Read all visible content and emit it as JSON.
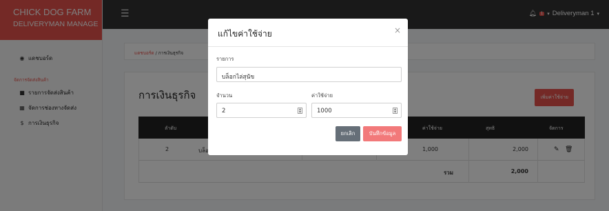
{
  "brand": {
    "title": "CHICK DOG FARM",
    "subtitle": "DELIVERYMAN MANAGE"
  },
  "sidebar": {
    "dashboard": {
      "icon": "dashboard-icon",
      "label": "แดชบอร์ด"
    },
    "section_label": "จัดการจัดส่งสินค้า",
    "items": [
      {
        "icon": "truck-icon",
        "label": "รายการจัดส่งสินค้า"
      },
      {
        "icon": "map-icon",
        "label": "จัดการช่องทางจัดส่ง"
      },
      {
        "icon": "dollar-icon",
        "label": "การเงินธุรกิจ"
      }
    ]
  },
  "topbar": {
    "user_name": "Deliveryman 1",
    "notification_count": "1"
  },
  "breadcrumb": {
    "home": "แดชบอร์ด",
    "separator": " / ",
    "current": "การเงินธุรกิจ"
  },
  "page": {
    "title": "การเงินธุรกิจ",
    "add_button": "เพิ่มค่าใช้จ่าย"
  },
  "table": {
    "headers": {
      "no": "ลำดับ",
      "expense": "ค่าใช้จ่าย",
      "total": "สุทธิ",
      "actions": "จัดการ"
    },
    "rows": [
      {
        "no": "2",
        "item": "บล็อ",
        "expense": "1,000",
        "total": "2,000"
      }
    ],
    "summary": {
      "label": "รวม",
      "total": "2,000"
    }
  },
  "modal": {
    "title": "แก้ไขค่าใช้จ่าย",
    "item_label": "รายการ",
    "item_value": "บล็อกไล่สุนัข",
    "qty_label": "จำนวน",
    "qty_value": "2",
    "cost_label": "ค่าใช้จ่าย",
    "cost_value": "1000",
    "cancel": "ยกเลิก",
    "save": "บันทึกข้อมูล"
  },
  "colors": {
    "accent": "#e9534c",
    "topbar": "#333333"
  }
}
